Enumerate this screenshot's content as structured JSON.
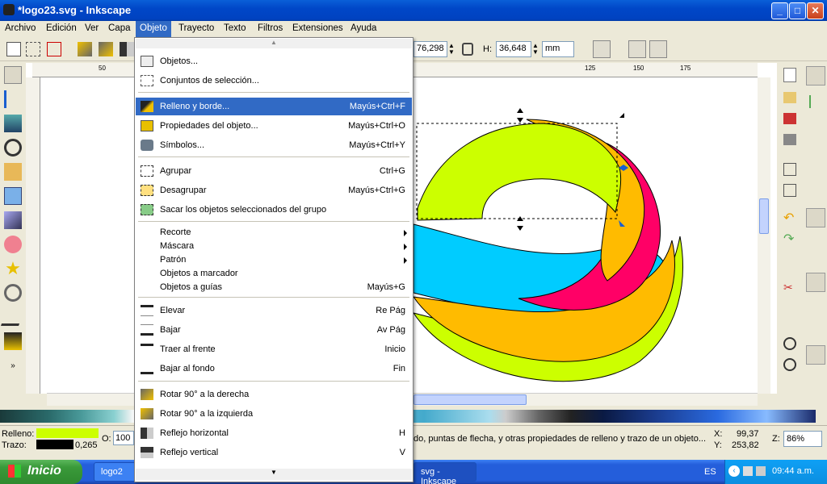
{
  "window": {
    "title": "*logo23.svg - Inkscape",
    "min": "_",
    "max": "□",
    "close": "✕"
  },
  "menubar": [
    "Archivo",
    "Edición",
    "Ver",
    "Capa",
    "Objeto",
    "Trayecto",
    "Texto",
    "Filtros",
    "Extensiones",
    "Ayuda"
  ],
  "toolbar": {
    "x_value": "76,298",
    "h_label": "H:",
    "h_value": "36,648",
    "unit": "mm"
  },
  "ruler": {
    "left": "50",
    "r1": "125",
    "r2": "150",
    "r3": "175"
  },
  "objeto_menu": {
    "items": [
      {
        "label": "Objetos...",
        "shortcut": ""
      },
      {
        "label": "Conjuntos de selección...",
        "shortcut": ""
      },
      {
        "label": "Relleno y borde...",
        "shortcut": "Mayús+Ctrl+F"
      },
      {
        "label": "Propiedades del objeto...",
        "shortcut": "Mayús+Ctrl+O"
      },
      {
        "label": "Símbolos...",
        "shortcut": "Mayús+Ctrl+Y"
      },
      {
        "label": "Agrupar",
        "shortcut": "Ctrl+G"
      },
      {
        "label": "Desagrupar",
        "shortcut": "Mayús+Ctrl+G"
      },
      {
        "label": "Sacar los objetos seleccionados del grupo",
        "shortcut": ""
      },
      {
        "label": "Recorte",
        "shortcut": ""
      },
      {
        "label": "Máscara",
        "shortcut": ""
      },
      {
        "label": "Patrón",
        "shortcut": ""
      },
      {
        "label": "Objetos a marcador",
        "shortcut": ""
      },
      {
        "label": "Objetos a guías",
        "shortcut": "Mayús+G"
      },
      {
        "label": "Elevar",
        "shortcut": "Re Pág"
      },
      {
        "label": "Bajar",
        "shortcut": "Av Pág"
      },
      {
        "label": "Traer al frente",
        "shortcut": "Inicio"
      },
      {
        "label": "Bajar al fondo",
        "shortcut": "Fin"
      },
      {
        "label": "Rotar 90° a la derecha",
        "shortcut": ""
      },
      {
        "label": "Rotar 90° a la izquierda",
        "shortcut": ""
      },
      {
        "label": "Reflejo horizontal",
        "shortcut": "H"
      },
      {
        "label": "Reflejo vertical",
        "shortcut": "V"
      }
    ]
  },
  "status": {
    "fill_label": "Relleno:",
    "stroke_label": "Trazo:",
    "stroke_width": "0,265",
    "opacity_label": "O:",
    "opacity_value": "100",
    "message": "do, puntas de flecha, y otras propiedades de relleno y trazo de un objeto...",
    "x_label": "X:",
    "x_value": "99,37",
    "y_label": "Y:",
    "y_value": "253,82",
    "zoom_label": "Z:",
    "zoom_value": "86%"
  },
  "taskbar": {
    "start": "Inicio",
    "task1": "logo2",
    "task2": "svg - Inkscape",
    "lang": "ES",
    "clock": "09:44 a.m."
  },
  "colors": {
    "fill_swatch": "#ccff00",
    "stroke_swatch": "#000000",
    "highlight": "#316ac5"
  }
}
